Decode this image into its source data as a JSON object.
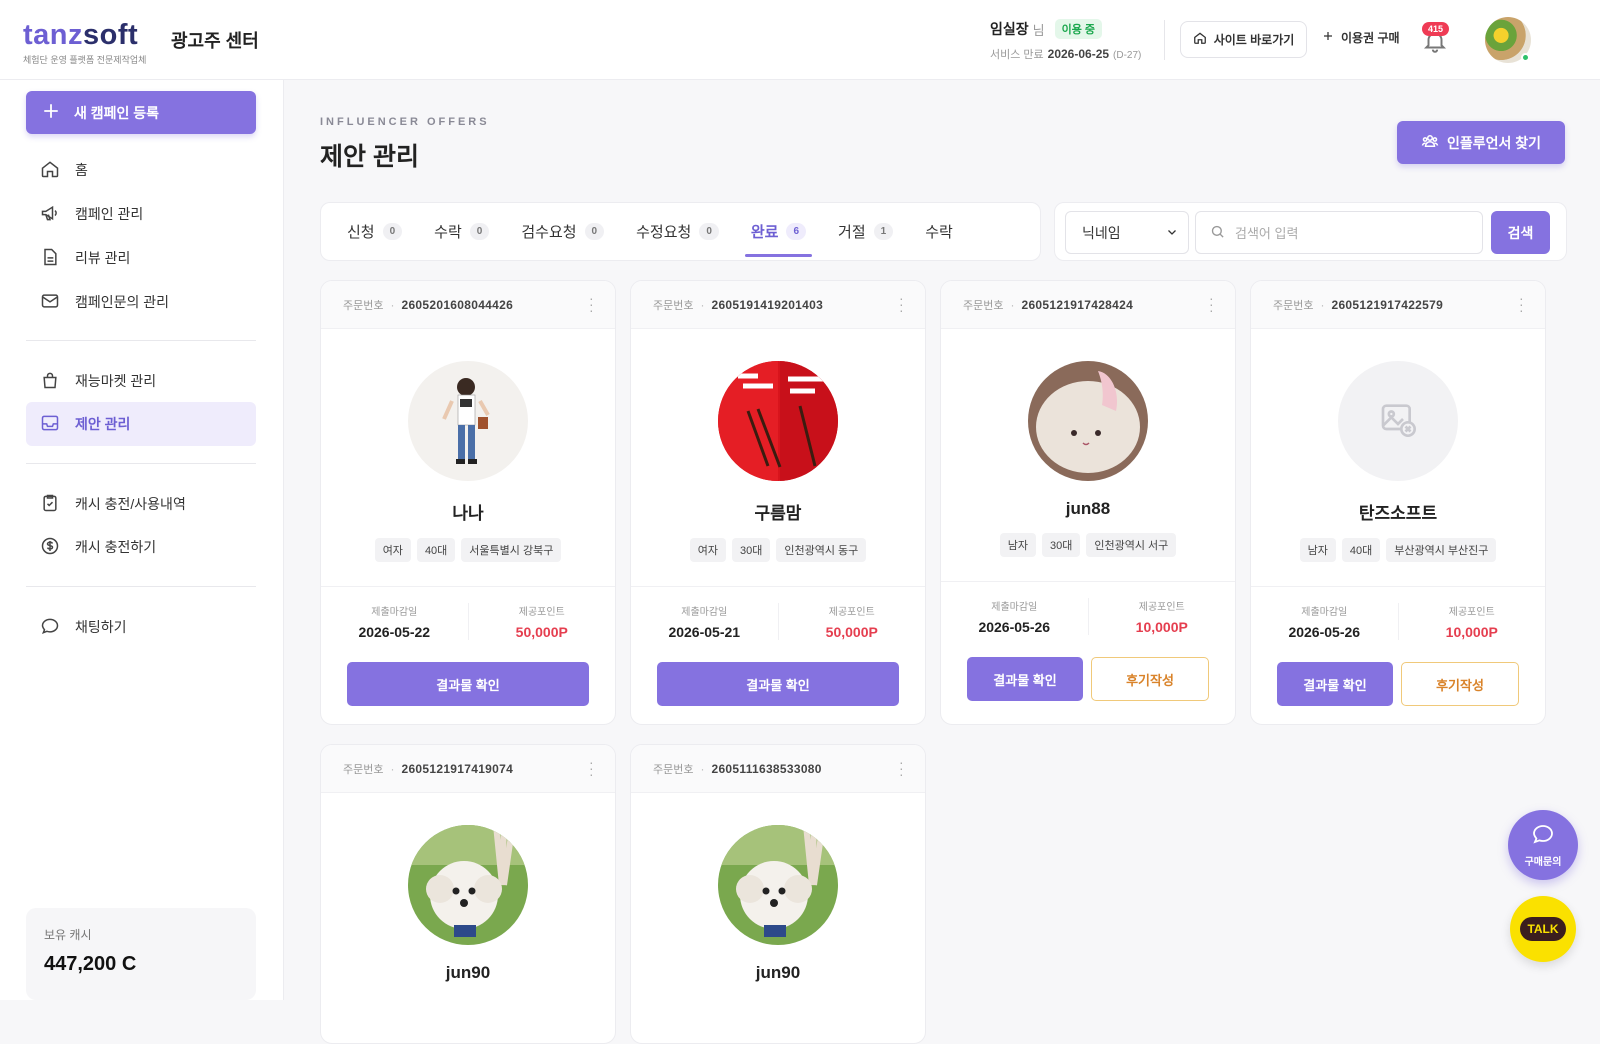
{
  "header": {
    "logo_part1": "tanz",
    "logo_part2": "soft",
    "logo_tagline": "체험단 운영 플랫폼 전문제작업체",
    "center_title": "광고주 센터",
    "user_name": "임실장",
    "user_suffix": "님",
    "status_badge": "이용 중",
    "expire_label": "서비스 만료",
    "expire_date": "2026-06-25",
    "expire_dday": "(D-27)",
    "site_button": "사이트 바로가기",
    "buy_link": "이용권 구매",
    "notification_count": "415"
  },
  "sidebar": {
    "new_campaign": "새 캠페인 등록",
    "groups": [
      [
        {
          "label": "홈",
          "icon": "home-icon"
        },
        {
          "label": "캠페인 관리",
          "icon": "megaphone-icon"
        },
        {
          "label": "리뷰 관리",
          "icon": "document-icon"
        },
        {
          "label": "캠페인문의 관리",
          "icon": "mail-icon"
        }
      ],
      [
        {
          "label": "재능마켓 관리",
          "icon": "bag-icon"
        },
        {
          "label": "제안 관리",
          "icon": "inbox-icon",
          "active": true
        }
      ],
      [
        {
          "label": "캐시 충전/사용내역",
          "icon": "clipboard-check-icon"
        },
        {
          "label": "캐시 충전하기",
          "icon": "dollar-icon"
        }
      ],
      [
        {
          "label": "채팅하기",
          "icon": "chat-icon"
        }
      ]
    ],
    "cash_label": "보유 캐시",
    "cash_value": "447,200 C"
  },
  "page": {
    "eyebrow": "INFLUENCER OFFERS",
    "title": "제안 관리",
    "find_button": "인플루언서 찾기"
  },
  "tabs": [
    {
      "label": "신청",
      "count": "0"
    },
    {
      "label": "수락",
      "count": "0"
    },
    {
      "label": "검수요청",
      "count": "0"
    },
    {
      "label": "수정요청",
      "count": "0"
    },
    {
      "label": "완료",
      "count": "6",
      "active": true
    },
    {
      "label": "거절",
      "count": "1"
    },
    {
      "label": "수락",
      "count": ""
    }
  ],
  "search": {
    "select_value": "닉네임",
    "placeholder": "검색어 입력",
    "button": "검색"
  },
  "card_labels": {
    "order_label": "주문번호",
    "deadline_label": "제출마감일",
    "point_label": "제공포인트",
    "result_button": "결과물 확인",
    "review_button": "후기작성"
  },
  "cards": [
    {
      "order_no": "2605201608044426",
      "name": "나나",
      "tags": [
        "여자",
        "40대",
        "서울특별시 강북구"
      ],
      "deadline": "2026-05-22",
      "point": "50,000P",
      "review": false,
      "photo": "fashion"
    },
    {
      "order_no": "2605191419201403",
      "name": "구름맘",
      "tags": [
        "여자",
        "30대",
        "인천광역시 동구"
      ],
      "deadline": "2026-05-21",
      "point": "50,000P",
      "review": false,
      "photo": "red"
    },
    {
      "order_no": "2605121917428424",
      "name": "jun88",
      "tags": [
        "남자",
        "30대",
        "인천광역시 서구"
      ],
      "deadline": "2026-05-26",
      "point": "10,000P",
      "review": true,
      "photo": "plush"
    },
    {
      "order_no": "2605121917422579",
      "name": "탄즈소프트",
      "tags": [
        "남자",
        "40대",
        "부산광역시 부산진구"
      ],
      "deadline": "2026-05-26",
      "point": "10,000P",
      "review": true,
      "photo": "none"
    },
    {
      "order_no": "2605121917419074",
      "name": "jun90",
      "tags": [],
      "deadline": "",
      "point": "",
      "review": false,
      "photo": "dog"
    },
    {
      "order_no": "2605111638533080",
      "name": "jun90",
      "tags": [],
      "deadline": "",
      "point": "",
      "review": false,
      "photo": "dog"
    }
  ],
  "floating": {
    "inquiry_label": "구매문의",
    "talk_label": "TALK"
  },
  "colors": {
    "primary": "#8572e0",
    "point_red": "#e53e4f",
    "review_orange": "#d9832a",
    "badge_green": "#1aa74d"
  }
}
